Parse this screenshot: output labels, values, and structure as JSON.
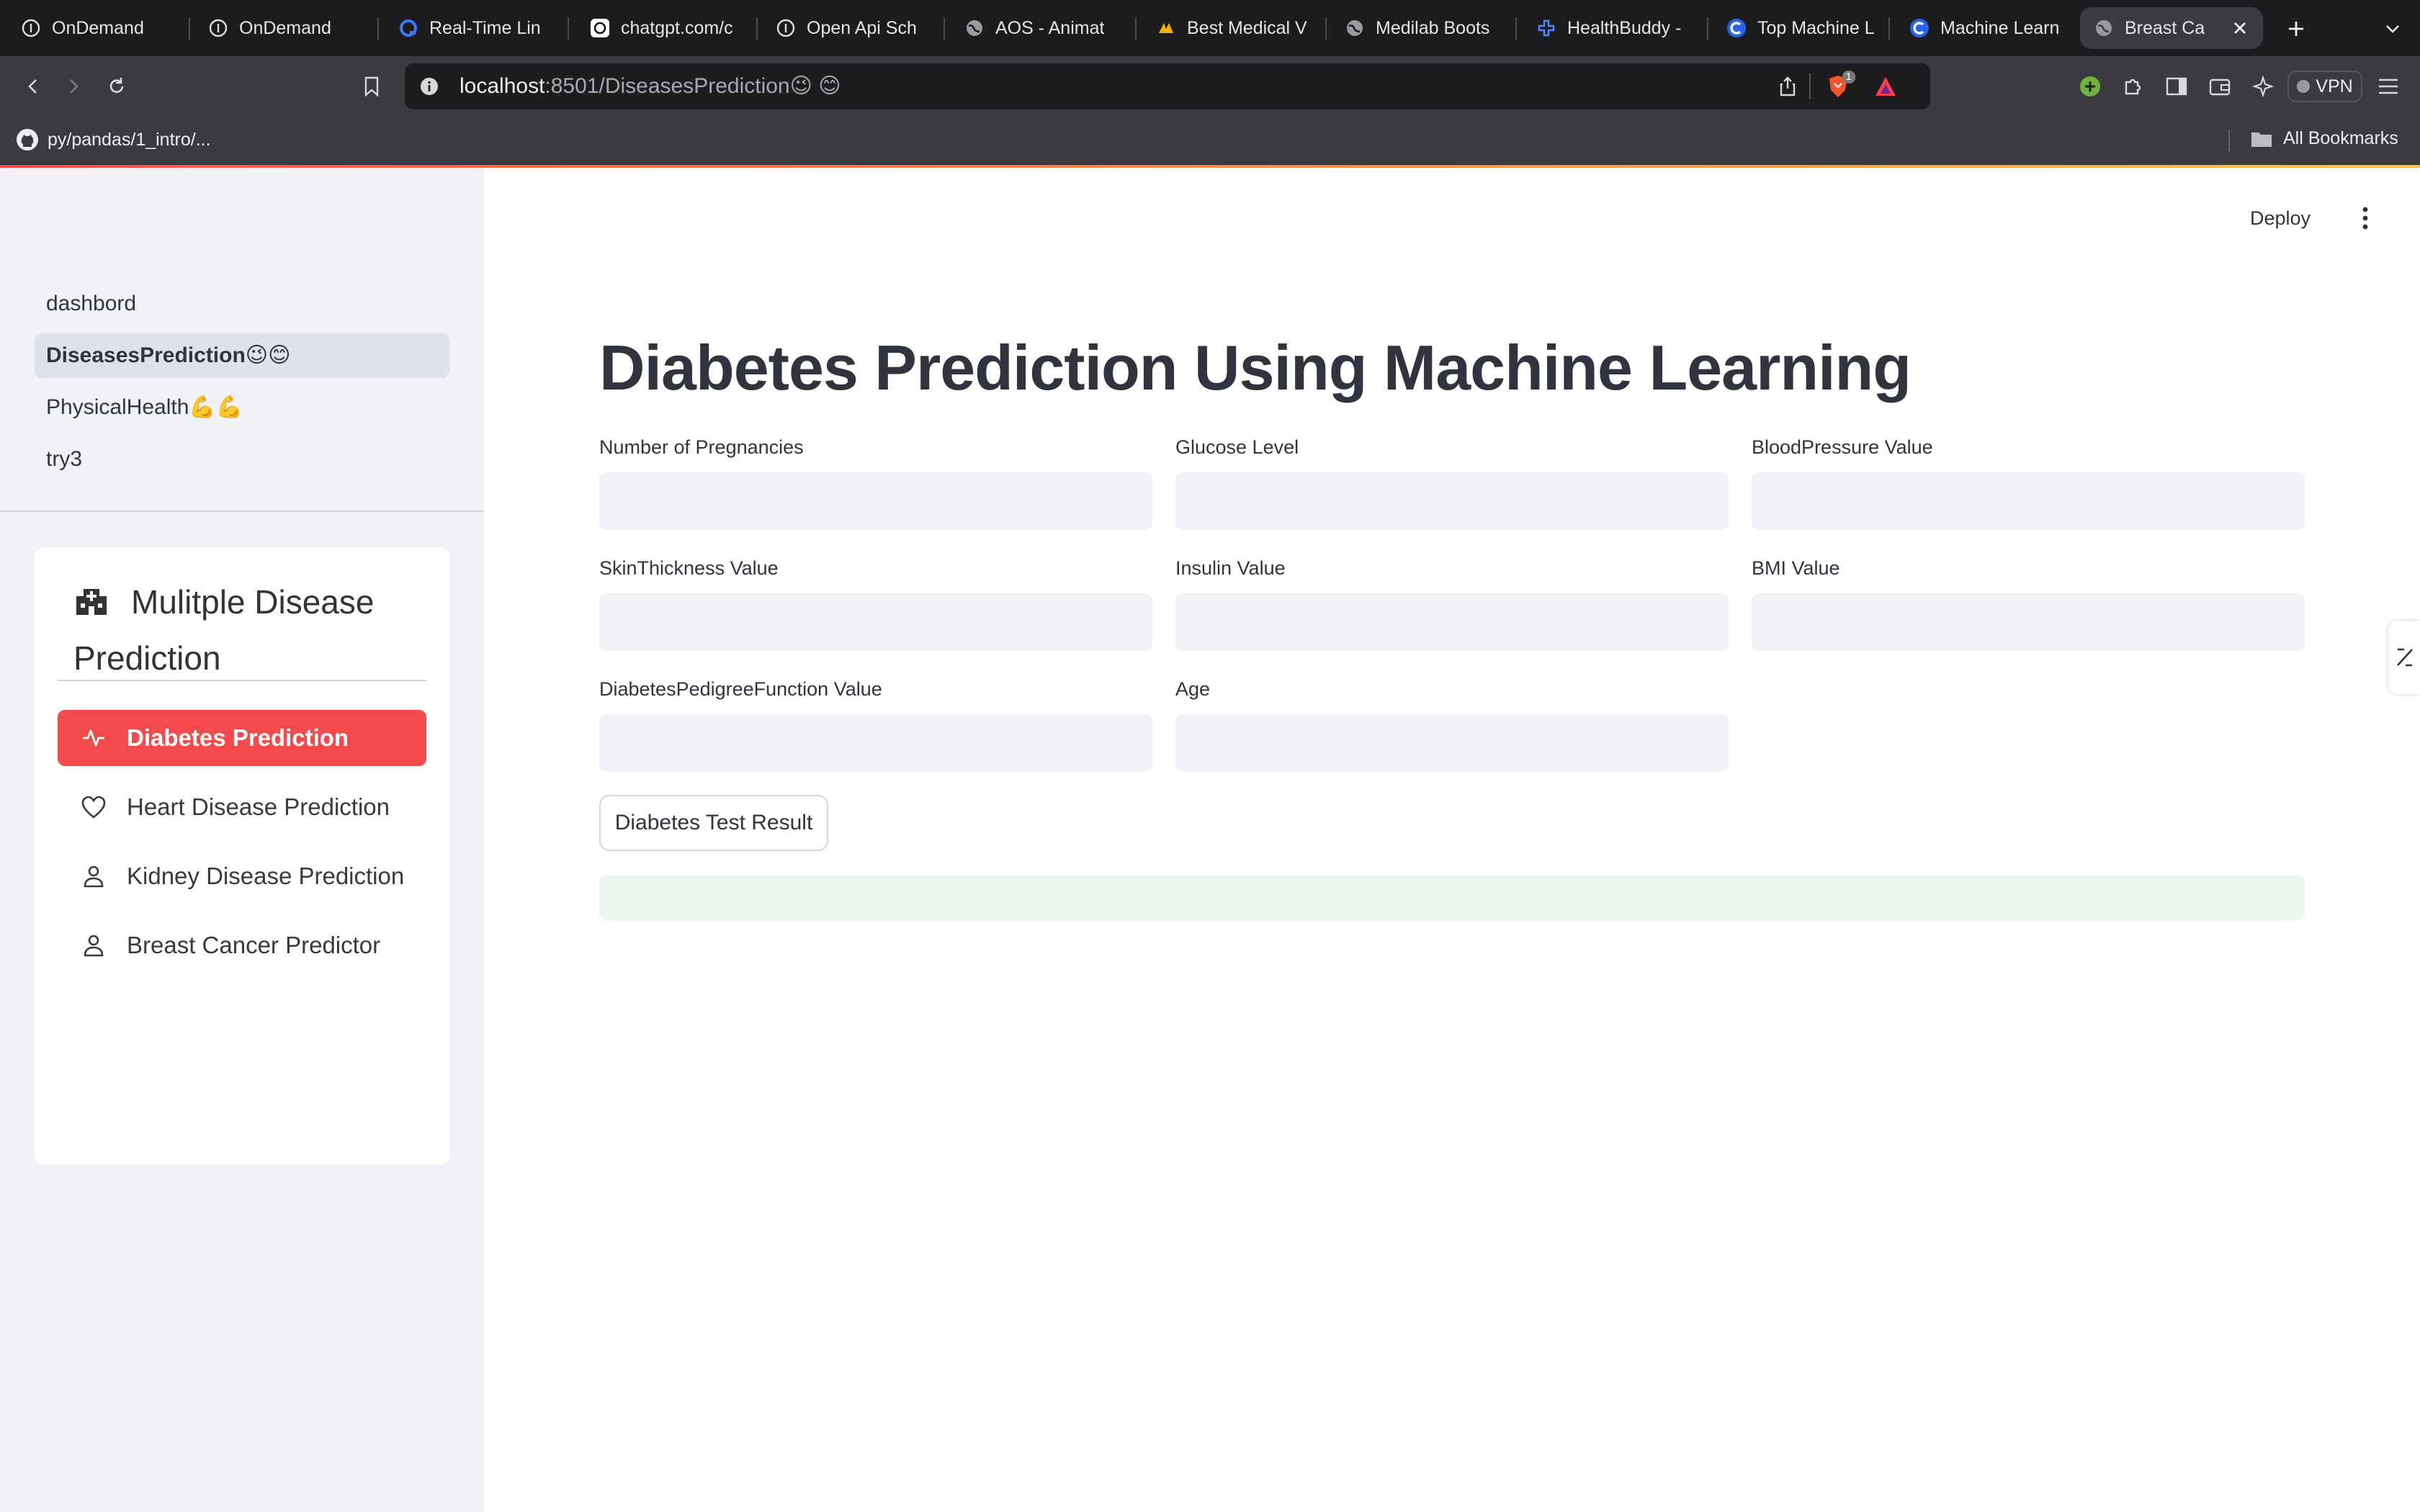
{
  "browser": {
    "tabs": [
      {
        "title": "OnDemand",
        "icon": "info-icon"
      },
      {
        "title": "OnDemand",
        "icon": "info-icon"
      },
      {
        "title": "Real-Time Lin",
        "icon": "q-logo-icon"
      },
      {
        "title": "chatgpt.com/c",
        "icon": "openai-icon"
      },
      {
        "title": "Open Api Sch",
        "icon": "info-icon"
      },
      {
        "title": "AOS - Animat",
        "icon": "globe-icon"
      },
      {
        "title": "Best Medical V",
        "icon": "brand-icon"
      },
      {
        "title": "Medilab Boots",
        "icon": "globe-icon"
      },
      {
        "title": "HealthBuddy -",
        "icon": "cross-icon"
      },
      {
        "title": "Top Machine L",
        "icon": "c-logo-icon"
      },
      {
        "title": "Machine Learn",
        "icon": "c-logo-icon"
      },
      {
        "title": "Breast Ca",
        "icon": "globe-icon",
        "active": true
      }
    ],
    "url_host": "localhost",
    "url_path": ":8501/DiseasesPrediction😉 😊",
    "bookmark": "py/pandas/1_intro/...",
    "all_bookmarks": "All Bookmarks",
    "vpn_label": "VPN",
    "shield_badge": "1"
  },
  "sidebar": {
    "nav": [
      {
        "label": "dashbord"
      },
      {
        "label": "DiseasesPrediction😉😊",
        "active": true
      },
      {
        "label": "PhysicalHealth💪💪"
      },
      {
        "label": "try3"
      }
    ],
    "menu_title": "Mulitple Disease Prediction",
    "menu_icon": "hospital-icon",
    "menu_items": [
      {
        "label": "Diabetes Prediction",
        "icon": "activity-icon",
        "selected": true
      },
      {
        "label": "Heart Disease Prediction",
        "icon": "heart-icon"
      },
      {
        "label": "Kidney Disease Prediction",
        "icon": "person-icon"
      },
      {
        "label": "Breast Cancer Predictor",
        "icon": "person-icon"
      }
    ]
  },
  "header": {
    "deploy": "Deploy"
  },
  "main": {
    "title": "Diabetes Prediction Using Machine Learning",
    "fields": [
      {
        "label": "Number of Pregnancies",
        "value": ""
      },
      {
        "label": "Glucose Level",
        "value": ""
      },
      {
        "label": "BloodPressure Value",
        "value": ""
      },
      {
        "label": "SkinThickness Value",
        "value": ""
      },
      {
        "label": "Insulin Value",
        "value": ""
      },
      {
        "label": "BMI Value",
        "value": ""
      },
      {
        "label": "DiabetesPedigreeFunction Value",
        "value": ""
      },
      {
        "label": "Age",
        "value": ""
      }
    ],
    "button": "Diabetes Test Result",
    "result": ""
  },
  "colors": {
    "accent": "#f34a4b",
    "sidebar_bg": "#f0f2f6",
    "success_bg": "#eaf7ec"
  }
}
